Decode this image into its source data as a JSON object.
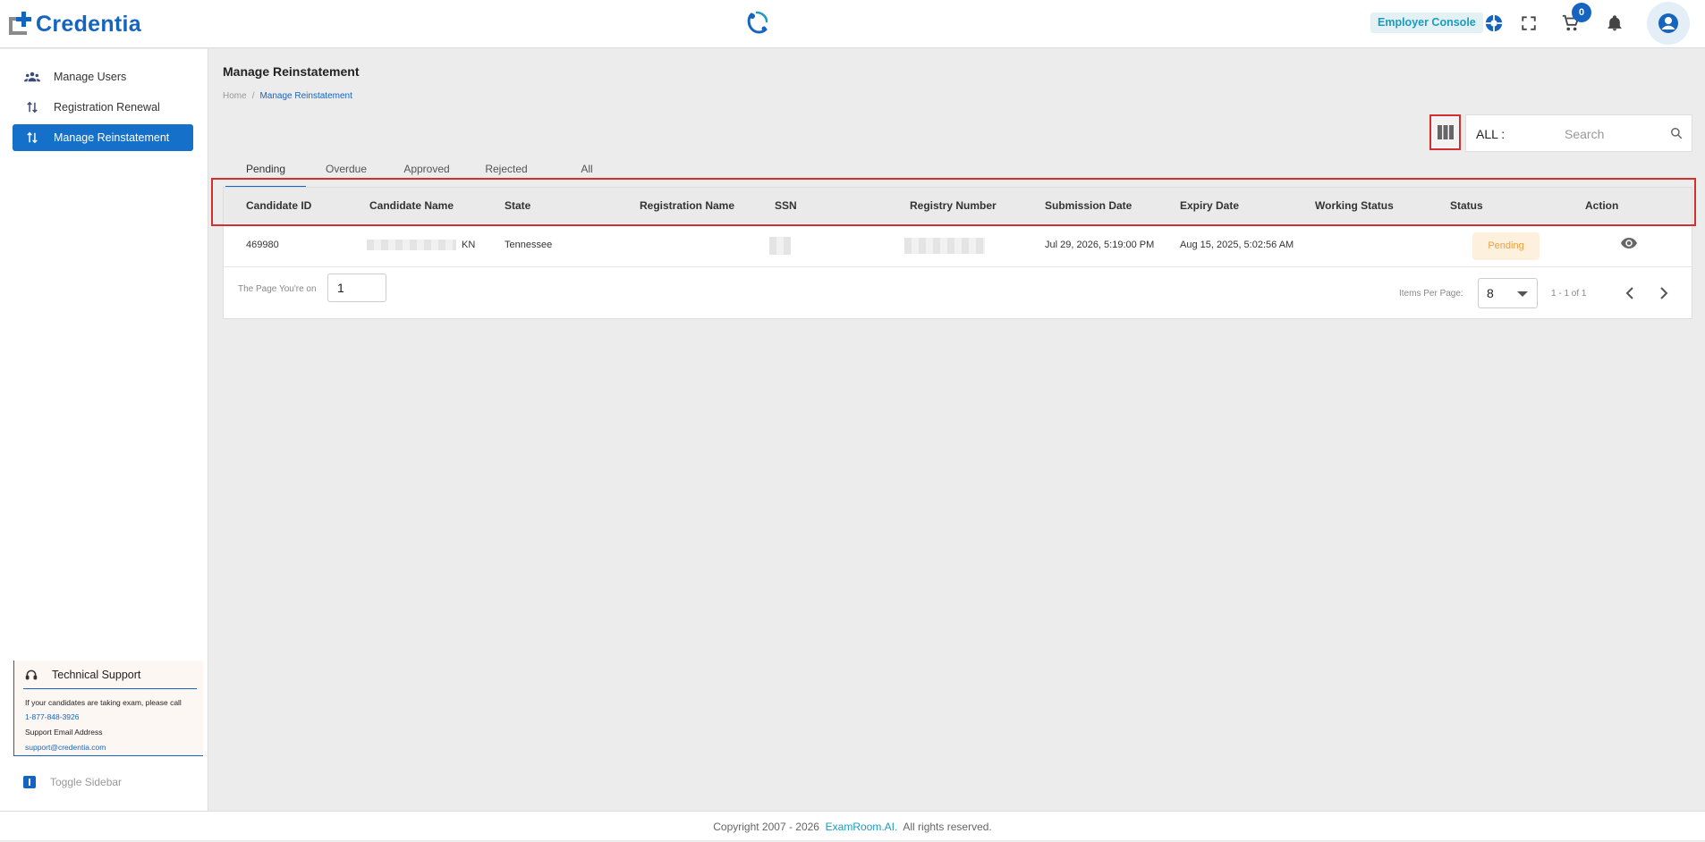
{
  "header": {
    "logo_text": "Credentia",
    "console_label": "Employer Console",
    "cart_count": "0",
    "icons": [
      "center-logo-icon",
      "support-globe-icon",
      "fullscreen-icon",
      "cart-icon",
      "notification-bell-icon",
      "account-icon"
    ]
  },
  "sidebar": {
    "items": [
      {
        "label": "Manage Users",
        "icon": "users-icon"
      },
      {
        "label": "Registration Renewal",
        "icon": "renewal-icon"
      },
      {
        "label": "Manage Reinstatement",
        "icon": "reinstatement-icon"
      }
    ],
    "support": {
      "title": "Technical Support",
      "line1": "If your candidates are taking exam, please call",
      "phone": "1-877-848-3926",
      "email_label": "Support Email Address",
      "email": "support@credentia.com"
    },
    "toggle_label": "Toggle Sidebar"
  },
  "main": {
    "title": "Manage Reinstatement",
    "breadcrumb": {
      "home": "Home",
      "sep": "/",
      "current": "Manage Reinstatement"
    },
    "search": {
      "all_label": "ALL :",
      "placeholder": "Search"
    },
    "tabs": [
      "Pending",
      "Overdue",
      "Approved",
      "Rejected",
      "All"
    ],
    "table": {
      "columns": [
        "Candidate ID",
        "Candidate Name",
        "State",
        "Registration Name",
        "SSN",
        "Registry Number",
        "Submission Date",
        "Expiry Date",
        "Working Status",
        "Status",
        "Action"
      ],
      "rows": [
        {
          "candidate_id": "469980",
          "candidate_name_suffix": "KN",
          "state": "Tennessee",
          "submission_date": "Jul 29, 2026, 5:19:00 PM",
          "expiry_date": "Aug 15, 2025, 5:02:56 AM",
          "status": "Pending"
        }
      ]
    },
    "pager": {
      "page_label": "The Page You're on",
      "page_value": "1",
      "per_page_label": "Items Per Page:",
      "per_page_value": "8",
      "range": "1 - 1 of 1"
    }
  },
  "footer": {
    "prefix": "Copyright 2007 - 2026",
    "brand": "ExamRoom.AI.",
    "suffix": "All rights reserved."
  },
  "colors": {
    "primary": "#1565c0",
    "nav_active": "#1470c8",
    "pending_bg": "#fdf0dc",
    "pending_text": "#f0a03c",
    "highlight": "#d32f2f"
  }
}
